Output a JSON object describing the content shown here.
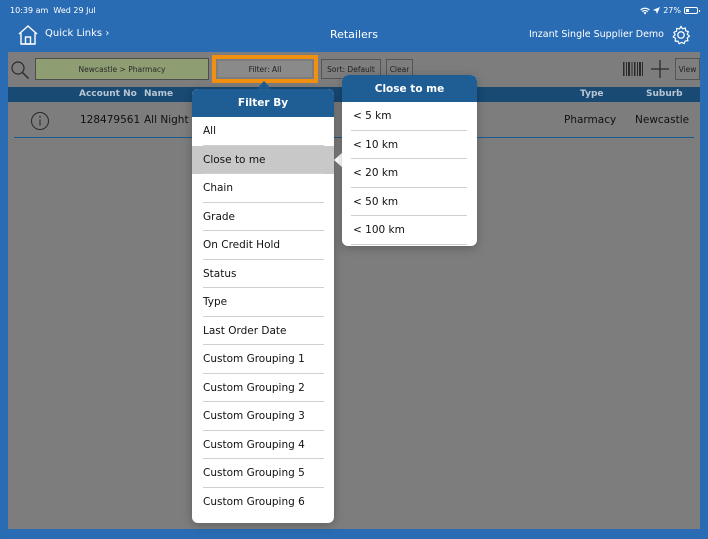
{
  "status_bar": {
    "time": "10:39 am",
    "date": "Wed 29 Jul",
    "battery": "27%"
  },
  "nav": {
    "quick_links": "Quick Links ›",
    "title": "Retailers",
    "demo_name": "Inzant Single Supplier Demo"
  },
  "toolbar": {
    "breadcrumb": "Newcastle > Pharmacy",
    "filter_label": "Filter: All",
    "sort_label": "Sort: Default",
    "clear_label": "Clear",
    "view_label": "View"
  },
  "table": {
    "columns": {
      "account_no": "Account No",
      "name": "Name",
      "type": "Type",
      "suburb": "Suburb"
    },
    "rows": [
      {
        "account_no": "128479561",
        "name": "All Night P",
        "type": "Pharmacy",
        "suburb": "Newcastle"
      }
    ]
  },
  "filter_popover": {
    "title": "Filter By",
    "items": [
      "All",
      "Close to me",
      "Chain",
      "Grade",
      "On Credit Hold",
      "Status",
      "Type",
      "Last Order Date",
      "Custom Grouping 1",
      "Custom Grouping 2",
      "Custom Grouping 3",
      "Custom Grouping 4",
      "Custom Grouping 5",
      "Custom Grouping 6"
    ],
    "selected": "Close to me"
  },
  "distance_popover": {
    "title": "Close to me",
    "items": [
      "< 5 km",
      "< 10 km",
      "< 20 km",
      "< 50 km",
      "< 100 km"
    ]
  },
  "colors": {
    "frame_blue": "#2a6cb3",
    "header_blue": "#1f5d95",
    "table_header": "#184a73",
    "highlight_orange": "#f08f10",
    "breadcrumb_green": "#8f9e72"
  }
}
